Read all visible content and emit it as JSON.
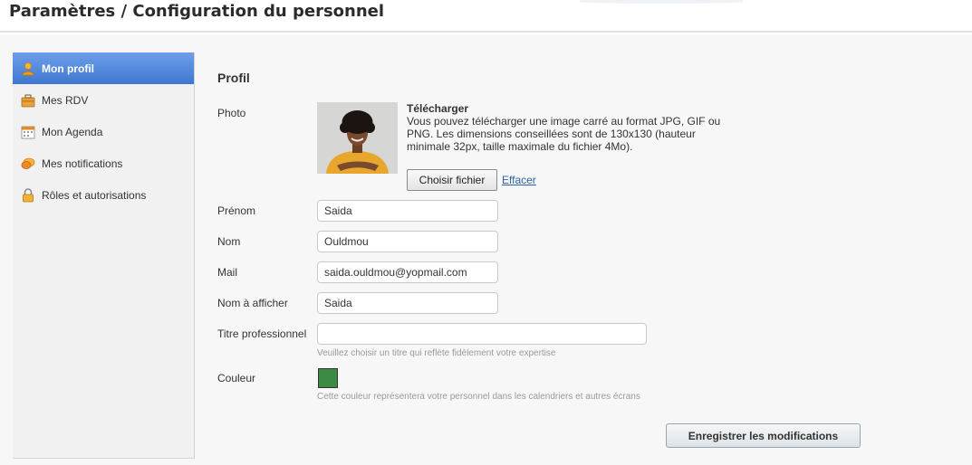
{
  "header": {
    "title": "Paramètres / Configuration du personnel"
  },
  "sidebar": {
    "items": [
      {
        "label": "Mon profil",
        "icon": "user-icon",
        "active": true
      },
      {
        "label": "Mes RDV",
        "icon": "briefcase-icon",
        "active": false
      },
      {
        "label": "Mon Agenda",
        "icon": "calendar-icon",
        "active": false
      },
      {
        "label": "Mes notifications",
        "icon": "chat-bubble-icon",
        "active": false
      },
      {
        "label": "Rôles et autorisations",
        "icon": "lock-icon",
        "active": false
      }
    ]
  },
  "profile": {
    "section_title": "Profil",
    "photo_label": "Photo",
    "upload_title": "Télécharger",
    "upload_description": "Vous pouvez télécharger une image carré au format JPG, GIF ou PNG. Les dimensions conseillées sont de 130x130 (hauteur minimale 32px, taille maximale du fichier 4Mo).",
    "choose_file_label": "Choisir fichier",
    "clear_label": "Effacer",
    "first_name": {
      "label": "Prénom",
      "value": "Saida"
    },
    "last_name": {
      "label": "Nom",
      "value": "Ouldmou"
    },
    "mail": {
      "label": "Mail",
      "value": "saida.ouldmou@yopmail.com"
    },
    "display_name": {
      "label": "Nom à afficher",
      "value": "Saida"
    },
    "job_title": {
      "label": "Titre professionnel",
      "value": "",
      "hint": "Veuillez choisir un titre qui reflète fidèlement votre expertise"
    },
    "color": {
      "label": "Couleur",
      "value": "#3c8a45",
      "hint": "Cette couleur représentera votre personnel dans les calendriers et autres écrans"
    },
    "save_label": "Enregistrer les modifications"
  },
  "colors": {
    "accent": "#4a82da",
    "link": "#2b5fa8"
  }
}
